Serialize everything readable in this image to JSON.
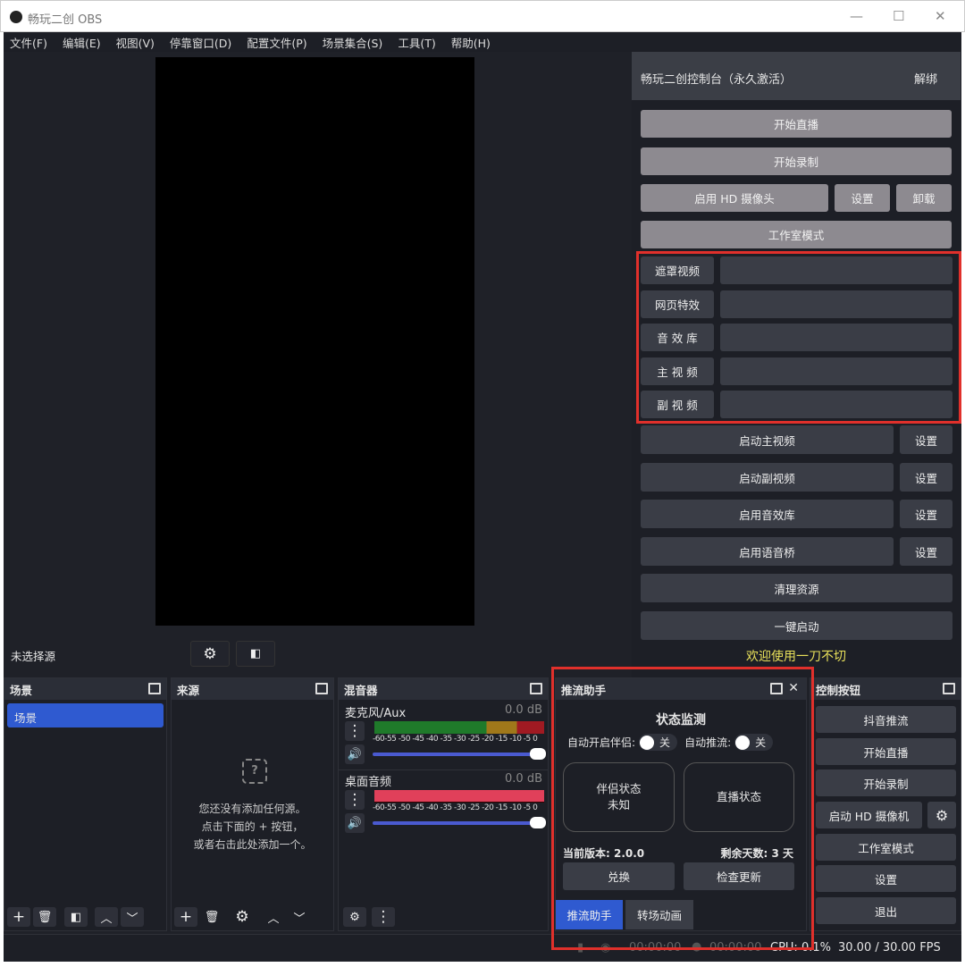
{
  "window": {
    "title": "畅玩二创 OBS"
  },
  "menu": [
    "文件(F)",
    "编辑(E)",
    "视图(V)",
    "停靠窗口(D)",
    "配置文件(P)",
    "场景集合(S)",
    "工具(T)",
    "帮助(H)"
  ],
  "panel": {
    "title": "畅玩二创控制台（永久激活）",
    "unbind": "解绑",
    "start_stream": "开始直播",
    "start_record": "开始录制",
    "hd_camera": "启用 HD 摄像头",
    "settings": "设置",
    "uninstall": "卸载",
    "studio_mode": "工作室模式",
    "media_rows": [
      "遮罩视频",
      "网页特效",
      "音 效 库",
      "主 视 频",
      "副 视 频"
    ],
    "action_rows": [
      "启动主视频",
      "启动副视频",
      "启用音效库",
      "启用语音桥"
    ],
    "row_settings": "设置",
    "clean": "清理资源",
    "one_click": "一键启动",
    "welcome": "欢迎使用一刀不切",
    "welcome_color": "#e8e05a"
  },
  "preview_bar": {
    "no_source": "未选择源"
  },
  "scenes": {
    "title": "场景",
    "items": [
      "场景"
    ]
  },
  "sources": {
    "title": "来源",
    "empty1": "您还没有添加任何源。",
    "empty2": "点击下面的 + 按钮，",
    "empty3": "或者右击此处添加一个。"
  },
  "mixer": {
    "title": "混音器",
    "scale": "-60-55 -50 -45 -40 -35 -30 -25 -20 -15 -10  -5  0",
    "channels": [
      {
        "name": "麦克风/Aux",
        "db": "0.0 dB"
      },
      {
        "name": "桌面音频",
        "db": "0.0 dB"
      }
    ]
  },
  "assistant": {
    "title": "推流助手",
    "heading": "状态监测",
    "auto_partner": "自动开启伴侣:",
    "auto_stream": "自动推流:",
    "off": "关",
    "partner_status": "伴侣状态",
    "partner_value": "未知",
    "live_status": "直播状态",
    "version": "当前版本: 2.0.0",
    "days": "剩余天数: 3 天",
    "redeem": "兑换",
    "check_update": "检查更新",
    "tabs": [
      "推流助手",
      "转场动画"
    ]
  },
  "controls": {
    "title": "控制按钮",
    "buttons": [
      "抖音推流",
      "开始直播",
      "开始录制",
      "启动 HD 摄像机",
      "工作室模式",
      "设置",
      "退出"
    ]
  },
  "status": {
    "stream_time": "00:00:00",
    "record_time": "00:00:00",
    "cpu": "CPU: 0.1%",
    "fps": "30.00 / 30.00 FPS"
  }
}
